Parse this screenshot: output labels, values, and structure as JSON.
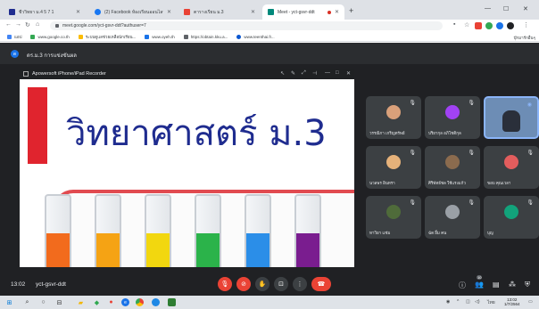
{
  "browser": {
    "tabs": [
      {
        "title": "ชีววิทยา ม.4 5 7 1",
        "favicon_color": "#1f2c8f",
        "active": false
      },
      {
        "title": "(2) Facebook ห้องเรียนออนไลน์",
        "favicon_color": "#1877f2",
        "active": false
      },
      {
        "title": "ตารางเรียน ม.3",
        "favicon_color": "#e94235",
        "active": false
      },
      {
        "title": "Meet - yct-gsvr-ddt",
        "favicon_color": "#00897b",
        "active": true
      }
    ],
    "new_tab": "+",
    "window_controls": {
      "minimize": "—",
      "maximize": "☐",
      "close": "✕"
    },
    "url": "meet.google.com/yct-gsvr-ddt?authuser=7",
    "bookmarks": [
      {
        "label": "แอป",
        "color": "#4285f4"
      },
      {
        "label": "www.google.co.th",
        "color": "#34a853"
      },
      {
        "label": "ระบบดูแลช่วยเหลือนักเรียน...",
        "color": "#fbbc04"
      },
      {
        "label": "www.oyeh.th",
        "color": "#1a73e8"
      },
      {
        "label": "https://obtain.kku.a...",
        "color": "#5f6368"
      },
      {
        "label": "www.teenthai.fr...",
        "color": "#0b57d0"
      }
    ],
    "bookmarks_right": "บุ๊กมาร์กอื่นๆ"
  },
  "meet": {
    "header_title": "ดร.ม.3 การแข่งขันผล",
    "header_avatar": "ด",
    "presentation": {
      "window_title": "Apowersoft iPhone/iPad Recorder",
      "slide_title": "วิทยาศาสตร์ ม.3",
      "liquid_colors": [
        "#f26b1d",
        "#f5a314",
        "#f2d70f",
        "#2bb34a",
        "#2b8ee8",
        "#7a1d8f"
      ]
    },
    "participants": [
      {
        "name": "วรรณิกา เกริญทรัพย์",
        "color": "#d9a07a"
      },
      {
        "name": "ปริยากุล อภิโชติกุล",
        "color": "#a142f4"
      },
      {
        "name": "",
        "color": "#4a6fa5",
        "video": true
      },
      {
        "name": "นวลพร อินทรา",
        "color": "#e6b27a"
      },
      {
        "name": "ศิริพัทธ์ชล ใช้แรงแก้ว",
        "color": "#8b6b4e"
      },
      {
        "name": "ขอบ คุณเวลา",
        "color": "#e35d5d"
      },
      {
        "name": "ทาวิยา แช่ม",
        "color": "#4f6b3a"
      },
      {
        "name": "ฉัด ยิ้ม คน",
        "color": "#9aa0a6"
      },
      {
        "name": "บุญ",
        "color": "#12a37b"
      }
    ],
    "footer": {
      "time": "13:02",
      "meeting_code": "yct-gsvr-ddt",
      "people_count": "10"
    }
  },
  "taskbar": {
    "clock_time": "13:02",
    "clock_date": "1/7/2564",
    "language": "ไทย"
  }
}
